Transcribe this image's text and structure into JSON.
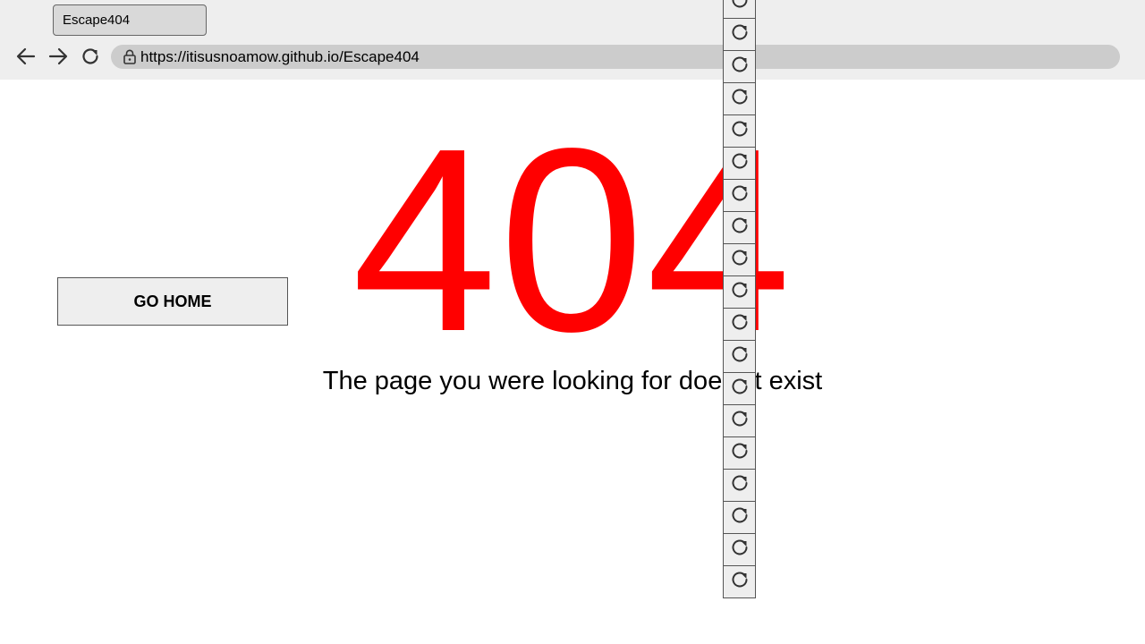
{
  "browser": {
    "tab_title": "Escape404",
    "url": "https://itisusnoamow.github.io/Escape404",
    "icons": {
      "back": "arrow-left-icon",
      "forward": "arrow-right-icon",
      "reload": "reload-icon",
      "lock": "lock-icon"
    }
  },
  "page": {
    "go_home_label": "GO HOME",
    "error_code": "404",
    "error_message": "The page you were looking for doesn't exist",
    "colors": {
      "error_code": "#ff0000",
      "chrome_background": "#eeeeee",
      "address_bar": "#cccccc"
    }
  },
  "reload_buttons": {
    "count": 19,
    "icon": "reload-icon"
  }
}
